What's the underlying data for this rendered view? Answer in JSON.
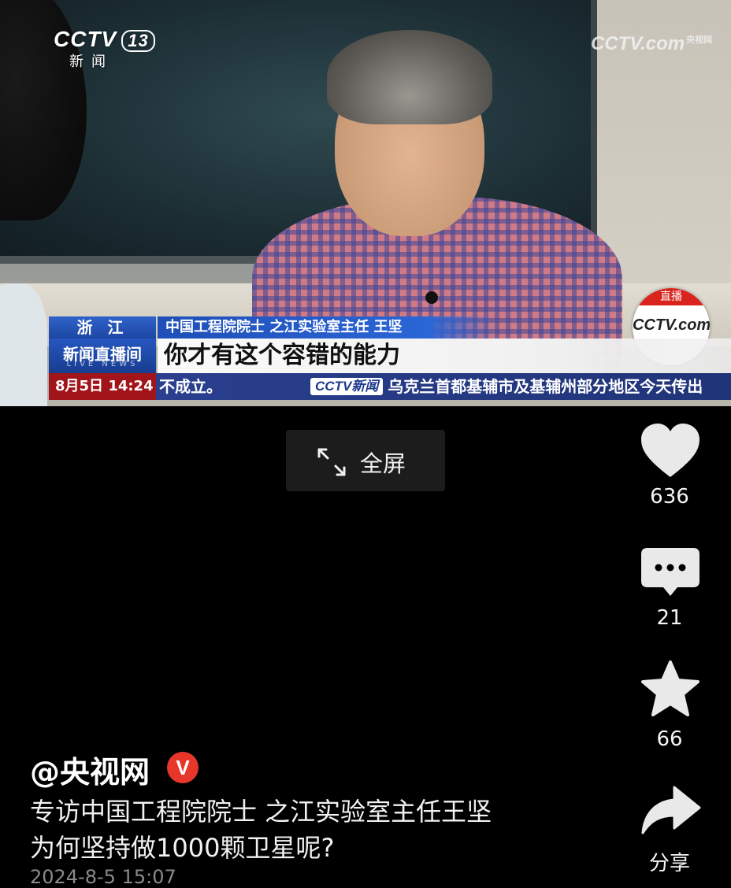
{
  "video": {
    "channel_logo": "CCTV",
    "channel_number": "13",
    "channel_sub": "新闻",
    "watermark": "CCTV.com",
    "watermark_small": "央视网",
    "live_label": "直播",
    "live_logo": "CCTV.com",
    "lower_third": {
      "location": "浙 江",
      "role": "中国工程院院士 之江实验室主任 王坚",
      "show_name": "新闻直播间",
      "show_name_en": "LIVE NEWS",
      "quote": "你才有这个容错的能力",
      "time": "8月5日 14:24",
      "ticker_prev": "不成立。",
      "ticker_brand": "CCTV新闻",
      "ticker_text": "乌克兰首都基辅市及基辅州部分地区今天传出"
    }
  },
  "controls": {
    "fullscreen_label": "全屏",
    "fullscreen_icon": "expand-arrows-icon"
  },
  "actions": {
    "like_count": "636",
    "comment_count": "21",
    "favorite_count": "66",
    "share_label": "分享"
  },
  "post": {
    "author": "@央视网",
    "verified_badge": "V",
    "desc_line1": "专访中国工程院院士 之江实验室主任王坚",
    "desc_line2": "为何坚持做1000颗卫星呢?",
    "date": "2024-8-5 15:07"
  },
  "colors": {
    "background": "#000000",
    "verified": "#e8362b",
    "lower_third_blue": "#1f4fb8",
    "time_red": "#a1141a"
  }
}
